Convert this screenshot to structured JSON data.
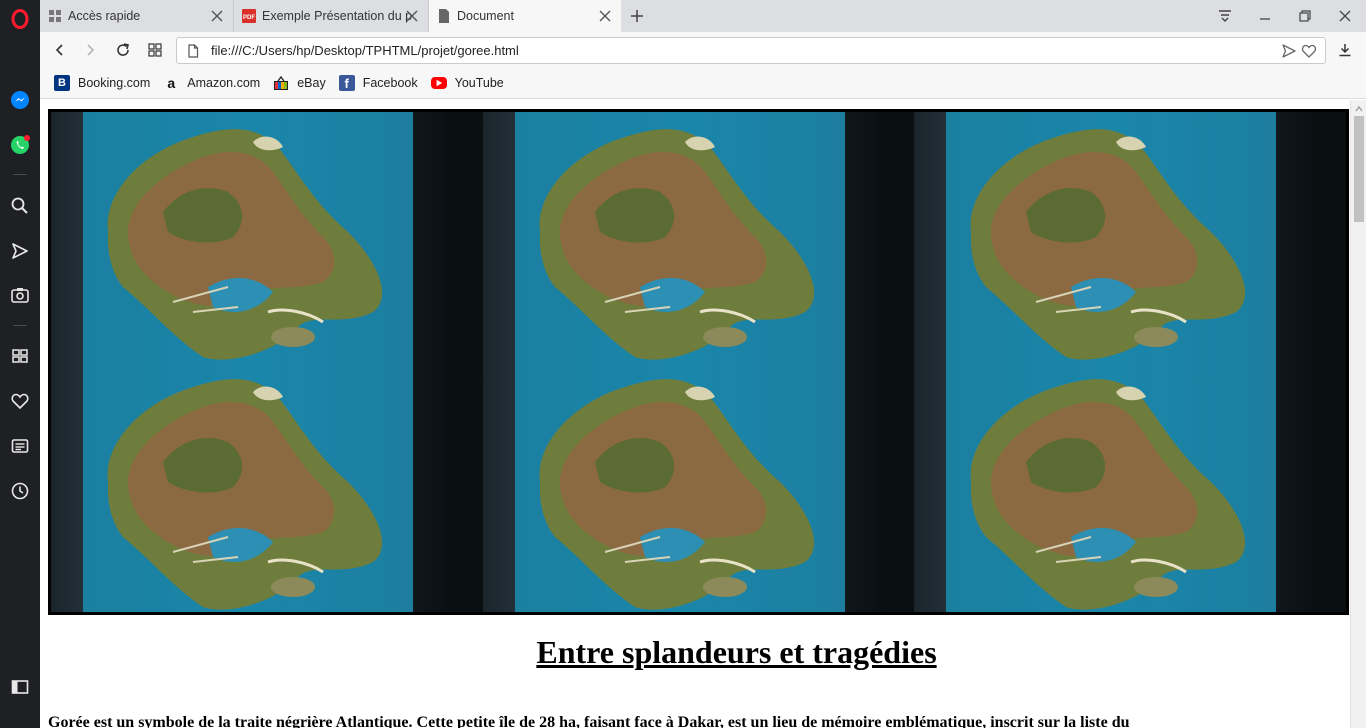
{
  "tabs": [
    {
      "title": "Accès rapide",
      "icon": "grid-icon"
    },
    {
      "title": "Exemple Présentation du p",
      "icon": "pdf-icon"
    },
    {
      "title": "Document",
      "icon": "document-icon"
    }
  ],
  "address": {
    "url": "file:///C:/Users/hp/Desktop/TPHTML/projet/goree.html"
  },
  "bookmarks": [
    {
      "label": "Booking.com",
      "icon": "booking-icon",
      "color": "#003580"
    },
    {
      "label": "Amazon.com",
      "icon": "amazon-icon",
      "color": "#ff9900"
    },
    {
      "label": "eBay",
      "icon": "ebay-icon",
      "color": "#e53238"
    },
    {
      "label": "Facebook",
      "icon": "facebook-icon",
      "color": "#3b5998"
    },
    {
      "label": "YouTube",
      "icon": "youtube-icon",
      "color": "#ff0000"
    }
  ],
  "page": {
    "heading": "Entre splandeurs et tragédies",
    "paragraph": "Gorée est un symbole de la traite négrière Atlantique. Cette petite île de 28 ha, faisant face à Dakar, est un lieu de mémoire emblématique, inscrit sur la liste du"
  },
  "colors": {
    "sidebar": "#1f2023",
    "opera_red": "#ff1b2d",
    "messenger": "#0084ff",
    "whatsapp": "#25d366"
  }
}
